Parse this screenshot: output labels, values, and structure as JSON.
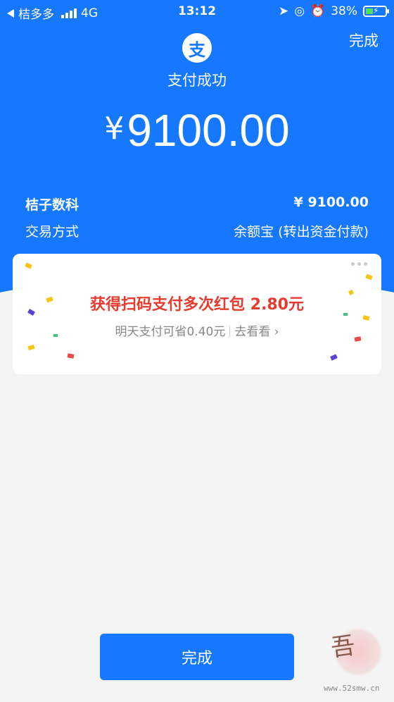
{
  "status_bar": {
    "carrier": "桔多多",
    "network": "4G",
    "time": "13:12",
    "battery": "38%"
  },
  "header": {
    "done_label": "完成",
    "logo_char": "支",
    "title": "支付成功"
  },
  "payment": {
    "currency_symbol": "¥",
    "amount": "9100.00"
  },
  "details": {
    "merchant_name": "桔子数科",
    "merchant_amount": "¥ 9100.00",
    "method_label": "交易方式",
    "method_value": "余额宝 (转出资金付款)"
  },
  "promo": {
    "title": "获得扫码支付多次红包 2.80元",
    "subtitle": "明天支付可省0.40元",
    "link": "去看看 ›"
  },
  "footer": {
    "done_label": "完成"
  },
  "watermark": {
    "seal_chars": "吾",
    "url": "www.52smw.cn"
  },
  "colors": {
    "primary": "#1677ff",
    "promo_red": "#e63b2e",
    "background": "#f4f4f4"
  }
}
